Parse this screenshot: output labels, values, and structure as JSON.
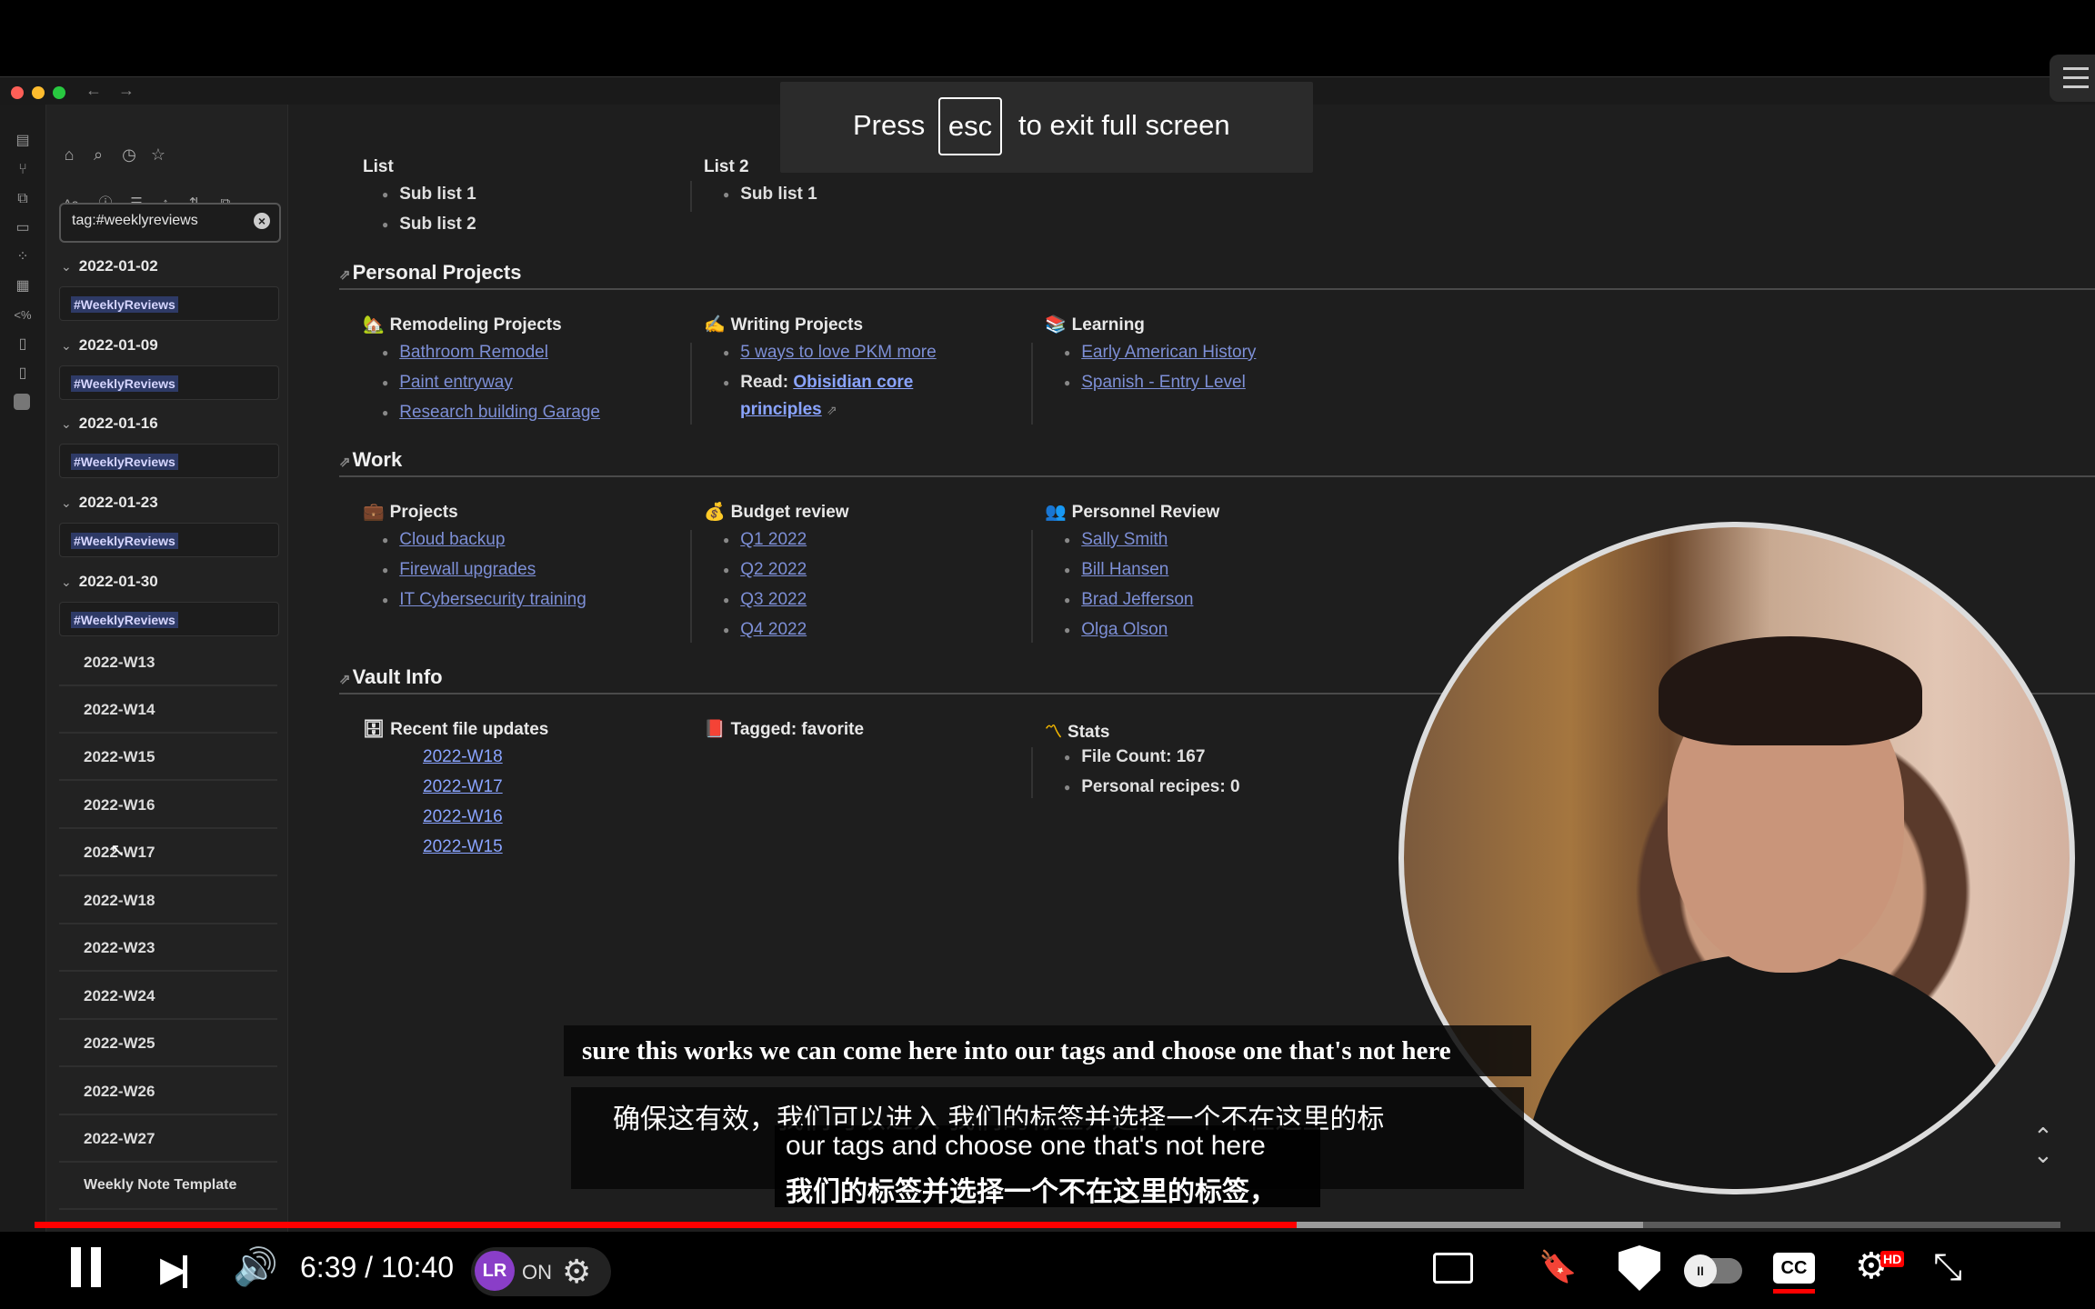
{
  "overlay": {
    "press": "Press",
    "key": "esc",
    "rest": "to exit full screen"
  },
  "sidebar": {
    "search_value": "tag:#weeklyreviews",
    "groups": [
      {
        "title": "2022-01-02",
        "tag": "#WeeklyReviews"
      },
      {
        "title": "2022-01-09",
        "tag": "#WeeklyReviews"
      },
      {
        "title": "2022-01-16",
        "tag": "#WeeklyReviews"
      },
      {
        "title": "2022-01-23",
        "tag": "#WeeklyReviews"
      },
      {
        "title": "2022-01-30",
        "tag": "#WeeklyReviews"
      }
    ],
    "files": [
      "2022-W13",
      "2022-W14",
      "2022-W15",
      "2022-W16",
      "2022-W17",
      "2022-W18",
      "2022-W23",
      "2022-W24",
      "2022-W25",
      "2022-W26",
      "2022-W27",
      "Weekly Note Template"
    ]
  },
  "main": {
    "top": {
      "list1": {
        "title": "List",
        "items": [
          "Sub list 1",
          "Sub list 2"
        ]
      },
      "list2": {
        "title": "List 2",
        "items": [
          "Sub list 1"
        ]
      }
    },
    "personal": {
      "title": "Personal Projects",
      "col1": {
        "title": "Remodeling Projects",
        "icon": "🏡",
        "items": [
          "Bathroom Remodel",
          "Paint entryway",
          "Research building Garage"
        ]
      },
      "col2": {
        "title": "Writing Projects",
        "icon": "✍",
        "items": [
          "5 ways to love PKM more"
        ],
        "read_label": "Read:",
        "read_link1": "Obisidian core",
        "read_link2": "principles"
      },
      "col3": {
        "title": "Learning",
        "icon": "📚",
        "items": [
          "Early American History",
          "Spanish - Entry Level"
        ]
      }
    },
    "work": {
      "title": "Work",
      "col1": {
        "title": "Projects",
        "icon": "💼",
        "items": [
          "Cloud backup",
          "Firewall upgrades",
          "IT Cybersecurity training"
        ]
      },
      "col2": {
        "title": "Budget review",
        "icon": "💰",
        "items": [
          "Q1 2022",
          "Q2 2022",
          "Q3 2022",
          "Q4 2022"
        ]
      },
      "col3": {
        "title": "Personnel Review",
        "icon": "👥",
        "items": [
          "Sally Smith",
          "Bill Hansen",
          "Brad Jefferson",
          "Olga Olson"
        ]
      }
    },
    "vault": {
      "title": "Vault Info",
      "col1": {
        "title": "Recent file updates",
        "icon": "🗄",
        "items": [
          "2022-W18",
          "2022-W17",
          "2022-W16",
          "2022-W15"
        ]
      },
      "col2": {
        "title": "Tagged: favorite",
        "icon": "📕"
      },
      "col3": {
        "title": "Stats",
        "icon": "〽",
        "items": [
          "File Count: 167",
          "Personal recipes: 0"
        ]
      }
    }
  },
  "subtitles": {
    "en": "sure this works we can come here into our tags and choose one that's not here",
    "cn": "确保这有效，我们可以进入 我们的标签并选择一个不在这里的标",
    "en2": "our tags and choose one that's not here",
    "cn2": "我们的标签并选择一个不在这里的标签，"
  },
  "player": {
    "time": "6:39 / 10:40",
    "progress_played": 0.623,
    "progress_buffered": 0.794,
    "lr_on": "ON",
    "lr_logo": "LR",
    "hd_badge": "HD"
  }
}
